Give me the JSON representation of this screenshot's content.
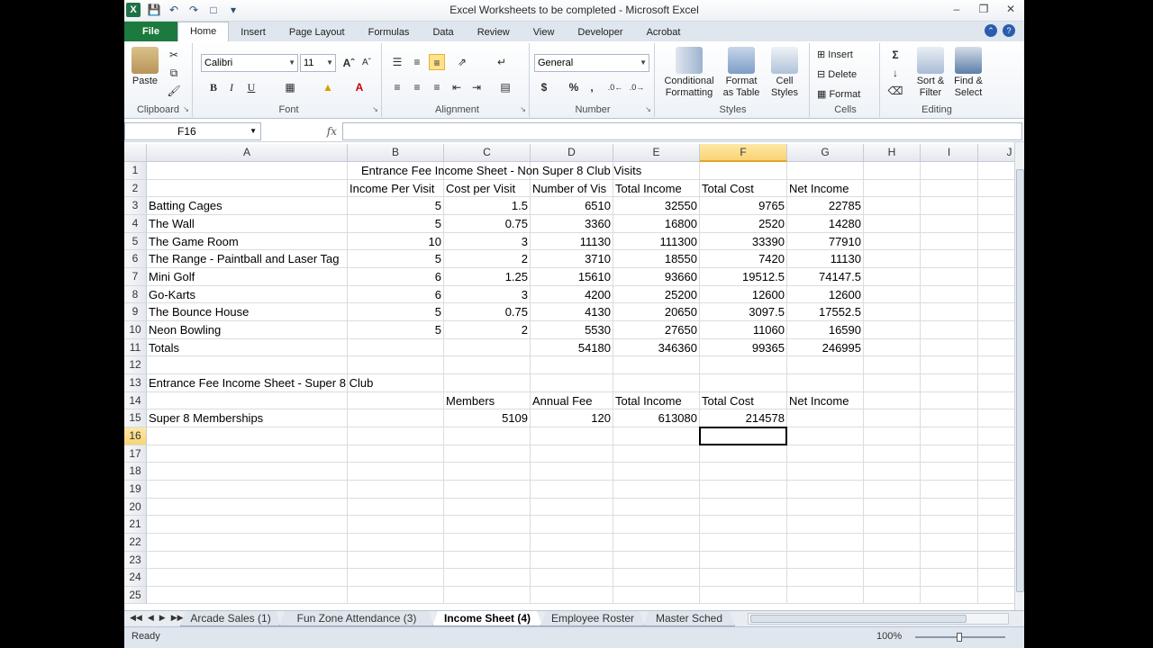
{
  "window": {
    "title": "Excel Worksheets to be completed  -  Microsoft Excel"
  },
  "ribbon": {
    "tabs": [
      "File",
      "Home",
      "Insert",
      "Page Layout",
      "Formulas",
      "Data",
      "Review",
      "View",
      "Developer",
      "Acrobat"
    ],
    "active_tab": "Home",
    "clipboard": {
      "paste": "Paste",
      "label": "Clipboard"
    },
    "font": {
      "name": "Calibri",
      "size": "11",
      "label": "Font"
    },
    "alignment": {
      "label": "Alignment"
    },
    "number": {
      "format": "General",
      "label": "Number",
      "currency": "$",
      "percent": "%",
      "comma": ","
    },
    "styles": {
      "conditional": "Conditional",
      "conditional2": "Formatting",
      "format_table": "Format",
      "format_table2": "as Table",
      "cell_styles": "Cell",
      "cell_styles2": "Styles",
      "label": "Styles"
    },
    "cells": {
      "insert": "Insert",
      "delete": "Delete",
      "format": "Format",
      "label": "Cells"
    },
    "editing": {
      "sort": "Sort &",
      "sort2": "Filter",
      "find": "Find &",
      "find2": "Select",
      "label": "Editing"
    }
  },
  "formula_bar": {
    "name_box": "F16",
    "fx": "fx",
    "value": ""
  },
  "columns": [
    "A",
    "B",
    "C",
    "D",
    "E",
    "F",
    "G",
    "H",
    "I",
    "J"
  ],
  "selected_column": "F",
  "selected_row": "16",
  "rows": [
    {
      "n": "1",
      "cells": [
        "",
        "",
        "",
        "",
        "",
        "",
        "",
        "",
        "",
        ""
      ],
      "overflow": {
        "col": 1,
        "text": "Entrance Fee Income Sheet - Non Super 8 Club Visits"
      }
    },
    {
      "n": "2",
      "cells": [
        "",
        "Income Per Visit",
        "Cost per Visit",
        "Number of Vis",
        "Total Income",
        "Total Cost",
        "Net Income",
        "",
        "",
        ""
      ]
    },
    {
      "n": "3",
      "cells": [
        "Batting Cages",
        "5",
        "1.5",
        "6510",
        "32550",
        "9765",
        "22785",
        "",
        "",
        ""
      ]
    },
    {
      "n": "4",
      "cells": [
        "The Wall",
        "5",
        "0.75",
        "3360",
        "16800",
        "2520",
        "14280",
        "",
        "",
        ""
      ]
    },
    {
      "n": "5",
      "cells": [
        "The Game Room",
        "10",
        "3",
        "11130",
        "111300",
        "33390",
        "77910",
        "",
        "",
        ""
      ]
    },
    {
      "n": "6",
      "cells": [
        "The Range - Paintball and Laser Tag",
        "5",
        "2",
        "3710",
        "18550",
        "7420",
        "11130",
        "",
        "",
        ""
      ]
    },
    {
      "n": "7",
      "cells": [
        "Mini Golf",
        "6",
        "1.25",
        "15610",
        "93660",
        "19512.5",
        "74147.5",
        "",
        "",
        ""
      ]
    },
    {
      "n": "8",
      "cells": [
        "Go-Karts",
        "6",
        "3",
        "4200",
        "25200",
        "12600",
        "12600",
        "",
        "",
        ""
      ]
    },
    {
      "n": "9",
      "cells": [
        "The Bounce House",
        "5",
        "0.75",
        "4130",
        "20650",
        "3097.5",
        "17552.5",
        "",
        "",
        ""
      ]
    },
    {
      "n": "10",
      "cells": [
        "Neon Bowling",
        "5",
        "2",
        "5530",
        "27650",
        "11060",
        "16590",
        "",
        "",
        ""
      ]
    },
    {
      "n": "11",
      "cells": [
        "Totals",
        "",
        "",
        "54180",
        "346360",
        "99365",
        "246995",
        "",
        "",
        ""
      ]
    },
    {
      "n": "12",
      "cells": [
        "",
        "",
        "",
        "",
        "",
        "",
        "",
        "",
        "",
        ""
      ]
    },
    {
      "n": "13",
      "cells": [
        "Entrance Fee Income Sheet - Super 8 Club",
        "",
        "",
        "",
        "",
        "",
        "",
        "",
        "",
        ""
      ]
    },
    {
      "n": "14",
      "cells": [
        "",
        "",
        "Members",
        "Annual Fee",
        "Total Income",
        "Total Cost",
        "Net Income",
        "",
        "",
        ""
      ]
    },
    {
      "n": "15",
      "cells": [
        "Super 8 Memberships",
        "",
        "5109",
        "120",
        "613080",
        "214578",
        "",
        "",
        "",
        ""
      ]
    },
    {
      "n": "16",
      "cells": [
        "",
        "",
        "",
        "",
        "",
        "",
        "",
        "",
        "",
        ""
      ]
    },
    {
      "n": "17",
      "cells": [
        "",
        "",
        "",
        "",
        "",
        "",
        "",
        "",
        "",
        ""
      ]
    },
    {
      "n": "18",
      "cells": [
        "",
        "",
        "",
        "",
        "",
        "",
        "",
        "",
        "",
        ""
      ]
    },
    {
      "n": "19",
      "cells": [
        "",
        "",
        "",
        "",
        "",
        "",
        "",
        "",
        "",
        ""
      ]
    },
    {
      "n": "20",
      "cells": [
        "",
        "",
        "",
        "",
        "",
        "",
        "",
        "",
        "",
        ""
      ]
    },
    {
      "n": "21",
      "cells": [
        "",
        "",
        "",
        "",
        "",
        "",
        "",
        "",
        "",
        ""
      ]
    },
    {
      "n": "22",
      "cells": [
        "",
        "",
        "",
        "",
        "",
        "",
        "",
        "",
        "",
        ""
      ]
    },
    {
      "n": "23",
      "cells": [
        "",
        "",
        "",
        "",
        "",
        "",
        "",
        "",
        "",
        ""
      ]
    },
    {
      "n": "24",
      "cells": [
        "",
        "",
        "",
        "",
        "",
        "",
        "",
        "",
        "",
        ""
      ]
    },
    {
      "n": "25",
      "cells": [
        "",
        "",
        "",
        "",
        "",
        "",
        "",
        "",
        "",
        ""
      ]
    }
  ],
  "sheet_tabs": [
    "Arcade Sales (1)",
    "Fun Zone Attendance (3)",
    "Income Sheet (4)",
    "Employee Roster",
    "Master Sched"
  ],
  "active_sheet": "Income Sheet (4)",
  "status": {
    "ready": "Ready",
    "zoom": "100%"
  }
}
